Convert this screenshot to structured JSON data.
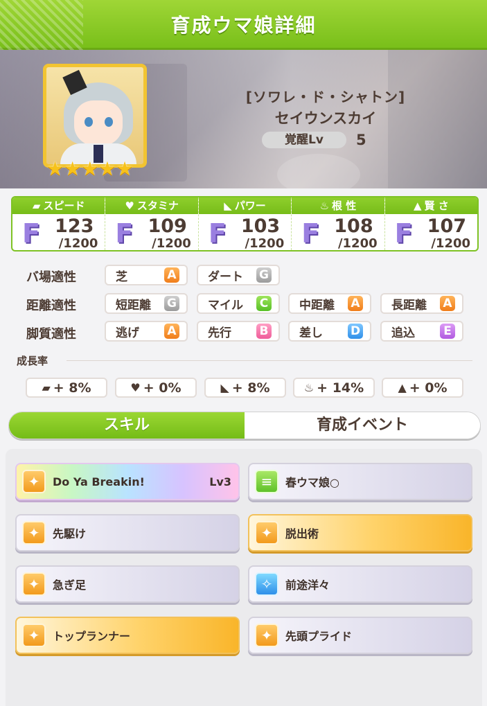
{
  "header": {
    "title": "育成ウマ娘詳細"
  },
  "character": {
    "title": "[ソワレ・ド・シャトン]",
    "name": "セイウンスカイ",
    "stars": [
      "★",
      "★",
      "★",
      "★",
      "★"
    ],
    "awaken_label": "覚醒Lv",
    "awaken_value": "5"
  },
  "stats": [
    {
      "icon": "shoe-icon",
      "glyph": "▰",
      "label": "スピード",
      "rank": "F",
      "value": "123",
      "max": "/1200"
    },
    {
      "icon": "heart-icon",
      "glyph": "♥",
      "label": "スタミナ",
      "rank": "F",
      "value": "109",
      "max": "/1200"
    },
    {
      "icon": "muscle-icon",
      "glyph": "◣",
      "label": "パワー",
      "rank": "F",
      "value": "103",
      "max": "/1200"
    },
    {
      "icon": "flame-icon",
      "glyph": "♨",
      "label": "根 性",
      "rank": "F",
      "value": "108",
      "max": "/1200"
    },
    {
      "icon": "graduation-cap-icon",
      "glyph": "▲",
      "label": "賢 さ",
      "rank": "F",
      "value": "107",
      "max": "/1200"
    }
  ],
  "aptitude": {
    "track": {
      "label": "バ場適性",
      "items": [
        {
          "name": "芝",
          "grade": "A"
        },
        {
          "name": "ダート",
          "grade": "G"
        }
      ]
    },
    "distance": {
      "label": "距離適性",
      "items": [
        {
          "name": "短距離",
          "grade": "G"
        },
        {
          "name": "マイル",
          "grade": "C"
        },
        {
          "name": "中距離",
          "grade": "A"
        },
        {
          "name": "長距離",
          "grade": "A"
        }
      ]
    },
    "style": {
      "label": "脚質適性",
      "items": [
        {
          "name": "逃げ",
          "grade": "A"
        },
        {
          "name": "先行",
          "grade": "B"
        },
        {
          "name": "差し",
          "grade": "D"
        },
        {
          "name": "追込",
          "grade": "E"
        }
      ]
    }
  },
  "growth": {
    "label": "成長率",
    "items": [
      {
        "icon": "shoe-icon",
        "glyph": "▰",
        "value": "+ 8%"
      },
      {
        "icon": "heart-icon",
        "glyph": "♥",
        "value": "+ 0%"
      },
      {
        "icon": "muscle-icon",
        "glyph": "◣",
        "value": "+ 8%"
      },
      {
        "icon": "flame-icon",
        "glyph": "♨",
        "value": "+ 14%"
      },
      {
        "icon": "graduation-cap-icon",
        "glyph": "▲",
        "value": "+ 0%"
      }
    ]
  },
  "tabs": [
    {
      "label": "スキル",
      "active": true
    },
    {
      "label": "育成イベント",
      "active": false
    }
  ],
  "skills": [
    {
      "name": "Do Ya Breakin!",
      "level": "Lv3",
      "style": "rainbow",
      "icon": "running-icon",
      "icon_color": "orange",
      "glyph": "✦"
    },
    {
      "name": "春ウマ娘○",
      "level": "",
      "style": "normal",
      "icon": "season-card-icon",
      "icon_color": "green",
      "glyph": "≡"
    },
    {
      "name": "先駆け",
      "level": "",
      "style": "normal",
      "icon": "running-icon",
      "icon_color": "orange",
      "glyph": "✦"
    },
    {
      "name": "脱出術",
      "level": "",
      "style": "gold",
      "icon": "running-icon",
      "icon_color": "orange",
      "glyph": "✦"
    },
    {
      "name": "急ぎ足",
      "level": "",
      "style": "normal",
      "icon": "running-icon",
      "icon_color": "orange",
      "glyph": "✦"
    },
    {
      "name": "前途洋々",
      "level": "",
      "style": "normal",
      "icon": "sparkle-icon",
      "icon_color": "blue",
      "glyph": "✧"
    },
    {
      "name": "トップランナー",
      "level": "",
      "style": "gold",
      "icon": "running-icon",
      "icon_color": "orange",
      "glyph": "✦"
    },
    {
      "name": "先頭プライド",
      "level": "",
      "style": "normal",
      "icon": "running-icon",
      "icon_color": "orange",
      "glyph": "✦"
    }
  ]
}
